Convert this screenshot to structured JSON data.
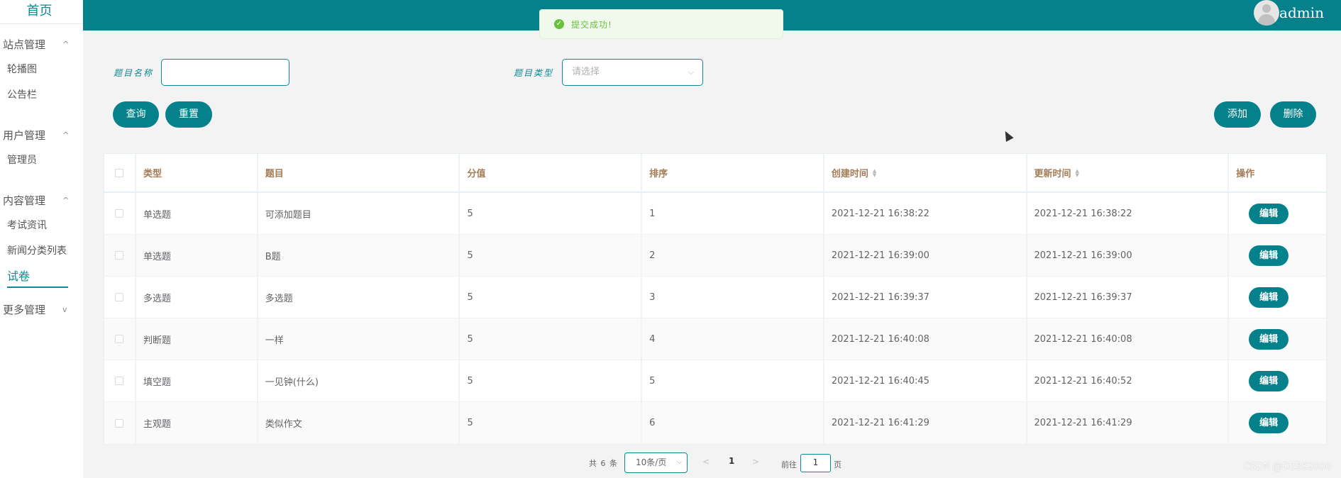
{
  "sidebar": {
    "home": "首页",
    "groups": [
      {
        "title": "站点管理",
        "chevron": "^",
        "items": [
          "轮播图",
          "公告栏"
        ]
      },
      {
        "title": "用户管理",
        "chevron": "^",
        "items": [
          "管理员"
        ]
      },
      {
        "title": "内容管理",
        "chevron": "^",
        "items": [
          "考试资讯",
          "新闻分类列表",
          "试卷"
        ]
      },
      {
        "title": "更多管理",
        "chevron": "v",
        "items": []
      }
    ],
    "active_item": "试卷"
  },
  "header": {
    "username": "admin",
    "avatar_icon": "user-avatar-icon"
  },
  "toast": {
    "icon": "check-circle-icon",
    "text": "提交成功!",
    "color": "#67c23a"
  },
  "search": {
    "name_label": "题目名称",
    "name_value": "",
    "type_label": "题目类型",
    "type_placeholder": "请选择",
    "query_button": "查询",
    "reset_button": "重置"
  },
  "actions": {
    "add_button": "添加",
    "delete_button": "删除"
  },
  "table": {
    "headers": [
      "类型",
      "题目",
      "分值",
      "排序",
      "创建时间",
      "更新时间",
      "操作"
    ],
    "rows": [
      {
        "type": "单选题",
        "title": "可添加题目",
        "score": "5",
        "order": "1",
        "created": "2021-12-21 16:38:22",
        "updated": "2021-12-21 16:38:22",
        "action": "编辑"
      },
      {
        "type": "单选题",
        "title": "B题",
        "score": "5",
        "order": "2",
        "created": "2021-12-21 16:39:00",
        "updated": "2021-12-21 16:39:00",
        "action": "编辑"
      },
      {
        "type": "多选题",
        "title": "多选题",
        "score": "5",
        "order": "3",
        "created": "2021-12-21 16:39:37",
        "updated": "2021-12-21 16:39:37",
        "action": "编辑"
      },
      {
        "type": "判断题",
        "title": "一样",
        "score": "5",
        "order": "4",
        "created": "2021-12-21 16:40:08",
        "updated": "2021-12-21 16:40:08",
        "action": "编辑"
      },
      {
        "type": "填空题",
        "title": "一见钟(什么)",
        "score": "5",
        "order": "5",
        "created": "2021-12-21 16:40:45",
        "updated": "2021-12-21 16:40:52",
        "action": "编辑"
      },
      {
        "type": "主观题",
        "title": "类似作文",
        "score": "5",
        "order": "6",
        "created": "2021-12-21 16:41:29",
        "updated": "2021-12-21 16:41:29",
        "action": "编辑"
      }
    ]
  },
  "pagination": {
    "total": "共 6 条",
    "page_size": "10条/页",
    "prev": "<",
    "current": "1",
    "next": ">",
    "goto_label": "前往",
    "goto_value": "1",
    "page_suffix": "页"
  },
  "watermark": "CSDN @DZBS2000",
  "theme": {
    "primary": "#04818a",
    "header_label": "#a37c57"
  }
}
